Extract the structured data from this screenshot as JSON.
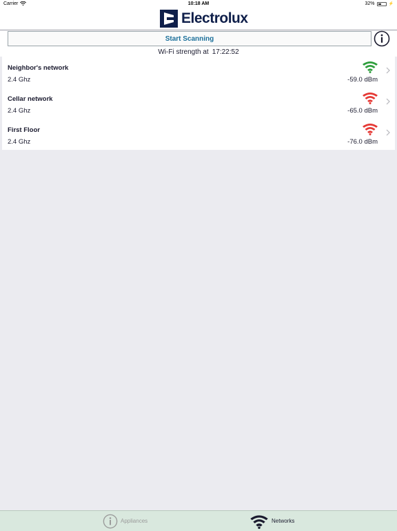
{
  "status_bar": {
    "carrier": "Carrier",
    "time": "10:18 AM",
    "battery": "32%"
  },
  "header": {
    "brand": "Electrolux",
    "brand_color": "#0f1f4a"
  },
  "toolbar": {
    "scan_label": "Start Scanning",
    "info_icon": "info-icon",
    "timestamp_label": "Wi-Fi strength at",
    "timestamp_time": "17:22:52"
  },
  "networks": [
    {
      "name": "Neighbor's network",
      "band": "2.4 Ghz",
      "signal": "-59.0 dBm",
      "signal_color": "#2e9e3c"
    },
    {
      "name": "Cellar network",
      "band": "2.4 Ghz",
      "signal": "-65.0 dBm",
      "signal_color": "#e53935"
    },
    {
      "name": "First Floor",
      "band": "2.4 Ghz",
      "signal": "-76.0 dBm",
      "signal_color": "#e53935"
    }
  ],
  "tab_bar": {
    "tabs": [
      {
        "label": "Appliances",
        "icon": "info-icon",
        "selected": false
      },
      {
        "label": "Networks",
        "icon": "wifi-icon",
        "selected": true
      }
    ],
    "background": "#d9e8de"
  },
  "colors": {
    "accent": "#1b6f9a",
    "background": "#ebebf0"
  }
}
